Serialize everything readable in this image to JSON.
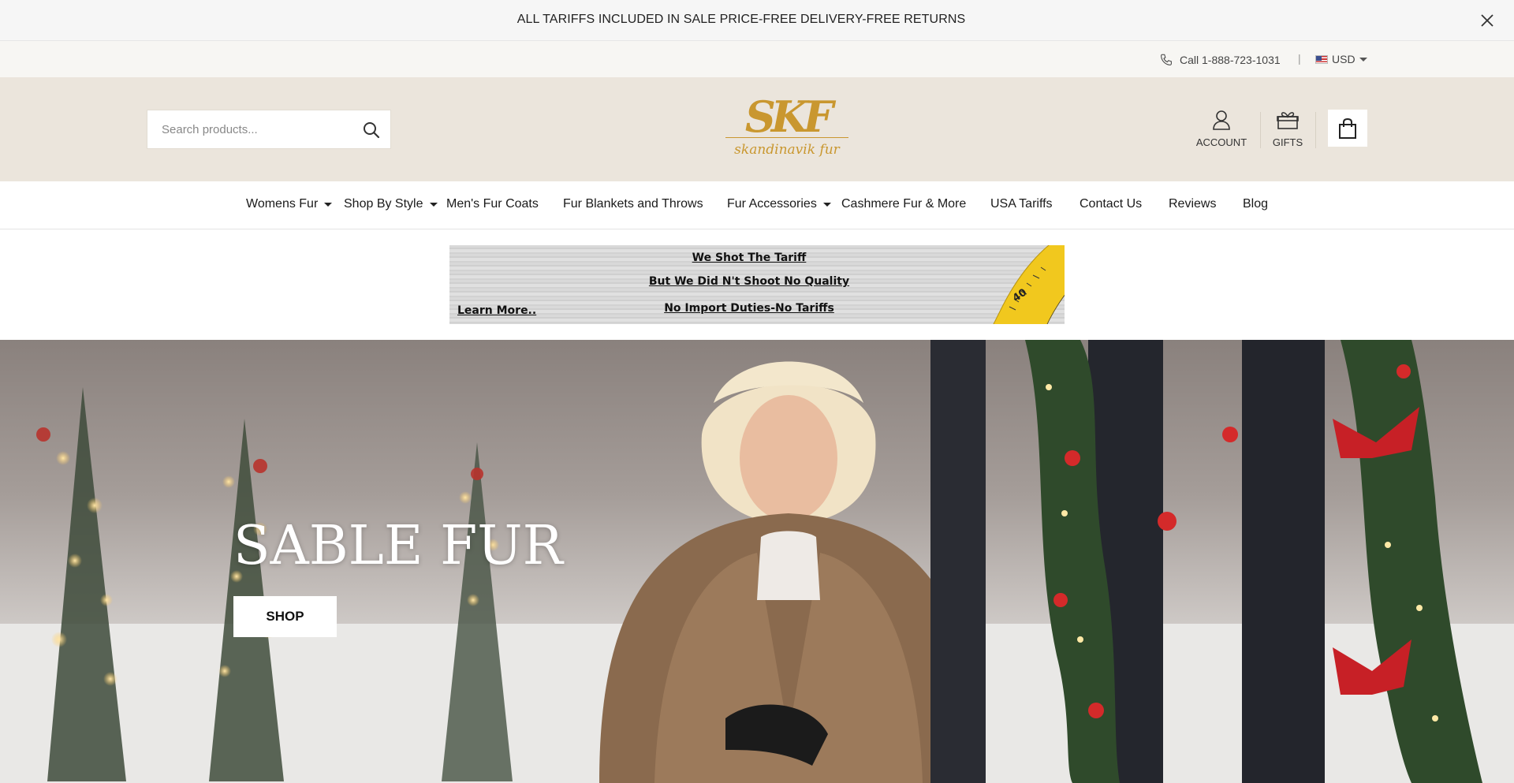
{
  "announcement": {
    "text": "ALL TARIFFS INCLUDED IN SALE PRICE-FREE DELIVERY-FREE RETURNS"
  },
  "utility": {
    "phone": "Call 1-888-723-1031",
    "separator": "|",
    "currency": "USD"
  },
  "header": {
    "search_placeholder": "Search products...",
    "logo_monogram": "SKF",
    "logo_text": "skandinavik fur",
    "account_label": "ACCOUNT",
    "gifts_label": "GIFTS"
  },
  "nav": {
    "items": [
      {
        "label": "Womens Fur"
      },
      {
        "label": "Shop By Style"
      },
      {
        "label": "Men's Fur Coats"
      },
      {
        "label": "Fur Blankets and Throws"
      },
      {
        "label": "Fur Accessories"
      },
      {
        "label": "Cashmere Fur & More"
      },
      {
        "label": "USA Tariffs"
      },
      {
        "label": "Contact Us"
      },
      {
        "label": "Reviews"
      },
      {
        "label": "Blog"
      }
    ]
  },
  "promo": {
    "line1": "We Shot The Tariff",
    "line2": "But We Did N't Shoot No Quality",
    "line3": "No Import Duties-No Tariffs",
    "learn_more": "Learn More..",
    "tape_number": "40"
  },
  "hero": {
    "title": "SABLE FUR",
    "button": "SHOP"
  },
  "colors": {
    "header_bg": "#ebe5dc",
    "logo_gold": "#c9972f",
    "announce_bg": "#f6f6f6"
  }
}
